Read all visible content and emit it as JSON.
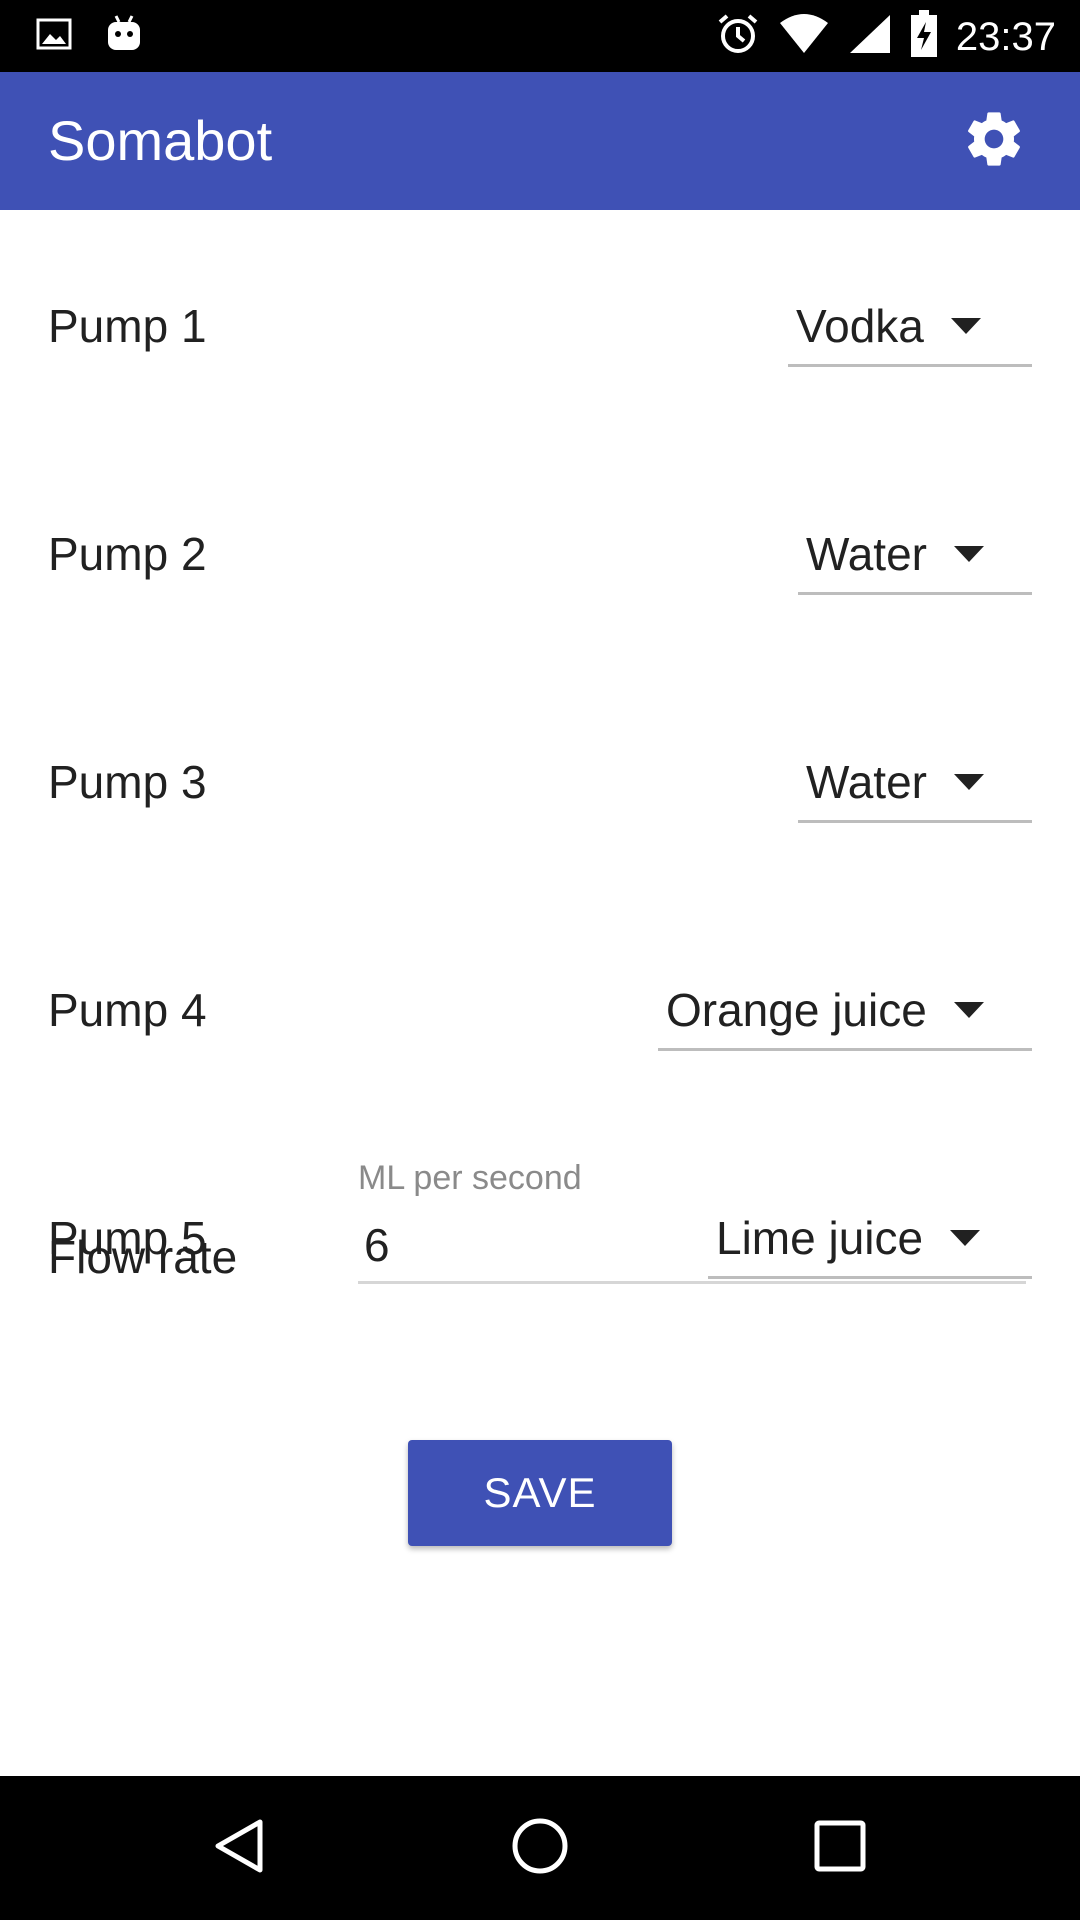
{
  "status_bar": {
    "time": "23:37",
    "icons": [
      "image-notification-icon",
      "android-notification-icon",
      "alarm-icon",
      "wifi-icon",
      "cell-signal-icon",
      "battery-charging-icon"
    ]
  },
  "app_bar": {
    "title": "Somabot",
    "settings_icon": "gear-icon",
    "background_color": "#3f51b5"
  },
  "pumps": [
    {
      "label": "Pump 1",
      "selected": "Vodka"
    },
    {
      "label": "Pump 2",
      "selected": "Water"
    },
    {
      "label": "Pump 3",
      "selected": "Water"
    },
    {
      "label": "Pump 4",
      "selected": "Orange juice"
    },
    {
      "label": "Pump 5",
      "selected": "Lime juice"
    }
  ],
  "flow_rate": {
    "label": "Flow rate",
    "hint": "ML per second",
    "value": "6"
  },
  "save_button": {
    "label": "SAVE",
    "color": "#3f51b5"
  },
  "nav_bar": {
    "icons": [
      "back-icon",
      "home-icon",
      "recents-icon"
    ]
  }
}
